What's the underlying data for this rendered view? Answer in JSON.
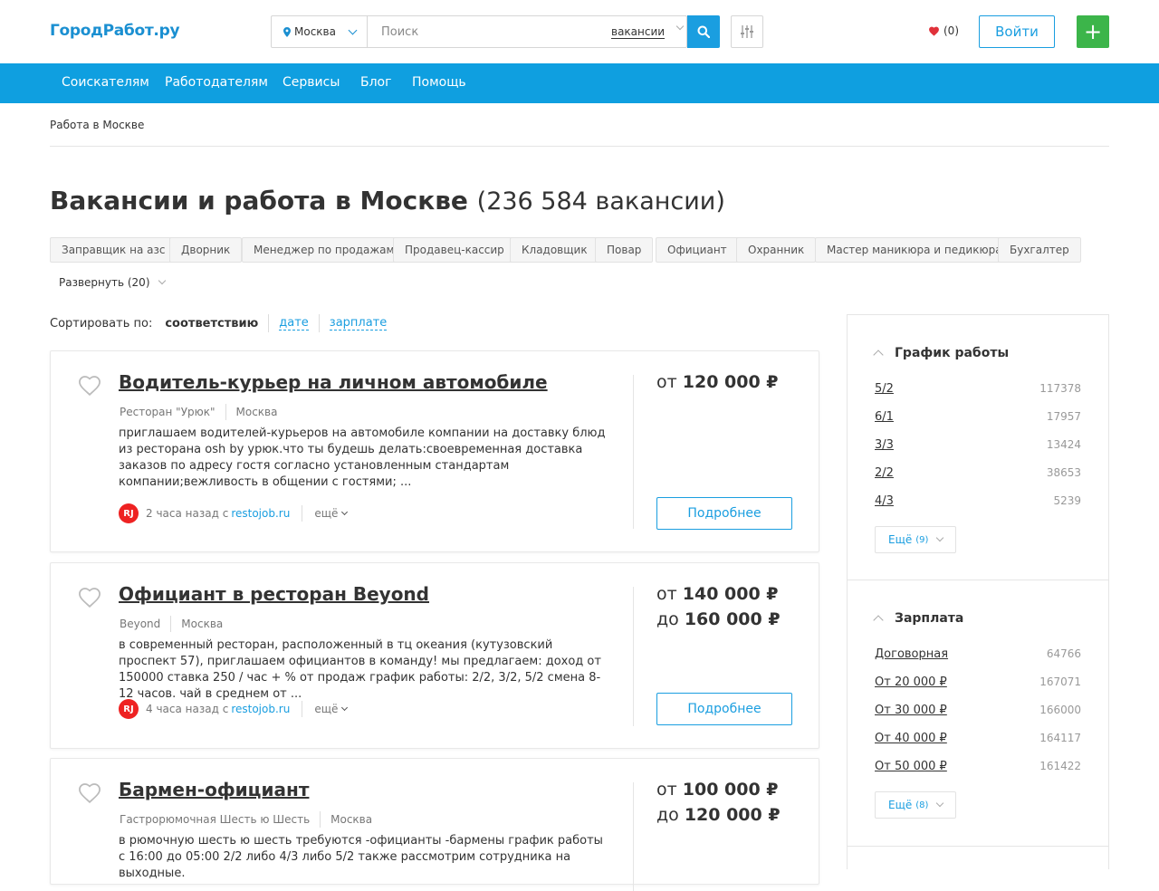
{
  "header": {
    "logo": "ГородРабот.ру",
    "city": "Москва",
    "search_placeholder": "Поиск",
    "search_type": "вакансии",
    "favorites": "(0)",
    "login": "Войти",
    "add": "+"
  },
  "nav": [
    "Соискателям",
    "Работодателям",
    "Сервисы",
    "Блог",
    "Помощь"
  ],
  "breadcrumb": "Работа в Москве",
  "page": {
    "title": "Вакансии и работа в Москве",
    "count": "(236 584 вакансии)"
  },
  "tags": [
    "Заправщик на азс",
    "Дворник",
    "Менеджер по продажам",
    "Продавец-кассир",
    "Кладовщик",
    "Повар",
    "Официант",
    "Охранник",
    "Мастер маникюра и педикюра",
    "Бухгалтер"
  ],
  "expand": "Развернуть (20)",
  "sort": {
    "label": "Сортировать по:",
    "active": "соответствию",
    "options": [
      "дате",
      "зарплате"
    ]
  },
  "vacancies": [
    {
      "title": "Водитель-курьер на личном автомобиле",
      "company": "Ресторан \"Урюк\"",
      "city": "Москва",
      "description": "приглашаем водителей-курьеров на автомобиле компании на доставку блюд из ресторана osh by урюк.что ты будешь делать:своевременная доставка заказов по адресу гостя согласно установленным стандартам компании;вежливость в общении с гостями; ...",
      "source_logo": "RJ",
      "time": "2 часа назад с",
      "source": "restojob.ru",
      "more": "ещё",
      "salary_from": "от",
      "salary_from_value": "120 000 ₽",
      "salary_to": "",
      "salary_to_value": "",
      "details": "Подробнее"
    },
    {
      "title": "Официант в ресторан Beyond",
      "company": "Beyond",
      "city": "Москва",
      "description": "в современный ресторан, расположенный в тц океания (кутузовский проспект 57), приглашаем официантов в команду! мы предлагаем: доход от 150000 ставка 250 / час + % от продаж график работы: 2/2, 3/2, 5/2 смена 8-12 часов. чай в среднем от ...",
      "source_logo": "RJ",
      "time": "4 часа назад с",
      "source": "restojob.ru",
      "more": "ещё",
      "salary_from": "от",
      "salary_from_value": "140 000 ₽",
      "salary_to": "до",
      "salary_to_value": "160 000 ₽",
      "details": "Подробнее"
    },
    {
      "title": "Бармен-официант",
      "company": "Гастрорюмочная Шесть ю Шесть",
      "city": "Москва",
      "description": "в рюмочную шесть ю шесть требуются -официанты -бармены график работы с 16:00 до 05:00 2/2 либо 4/3 либо 5/2 также рассмотрим сотрудника на выходные.",
      "salary_from": "от",
      "salary_from_value": "100 000 ₽",
      "salary_to": "до",
      "salary_to_value": "120 000 ₽"
    }
  ],
  "filters": {
    "schedule": {
      "title": "График работы",
      "items": [
        {
          "label": "5/2",
          "count": "117378"
        },
        {
          "label": "6/1",
          "count": "17957"
        },
        {
          "label": "3/3",
          "count": "13424"
        },
        {
          "label": "2/2",
          "count": "38653"
        },
        {
          "label": "4/3",
          "count": "5239"
        }
      ],
      "more": "Ещё",
      "more_count": "(9)"
    },
    "salary": {
      "title": "Зарплата",
      "items": [
        {
          "label": "Договорная",
          "count": "64766"
        },
        {
          "label": "От 20 000 ₽",
          "count": "167071"
        },
        {
          "label": "От 30 000 ₽",
          "count": "166000"
        },
        {
          "label": "От 40 000 ₽",
          "count": "164117"
        },
        {
          "label": "От 50 000 ₽",
          "count": "161422"
        }
      ],
      "more": "Ещё",
      "more_count": "(8)"
    }
  },
  "colors": {
    "accent": "#0f9fe0",
    "green": "#3cb54a",
    "heart": "#e0313a"
  }
}
